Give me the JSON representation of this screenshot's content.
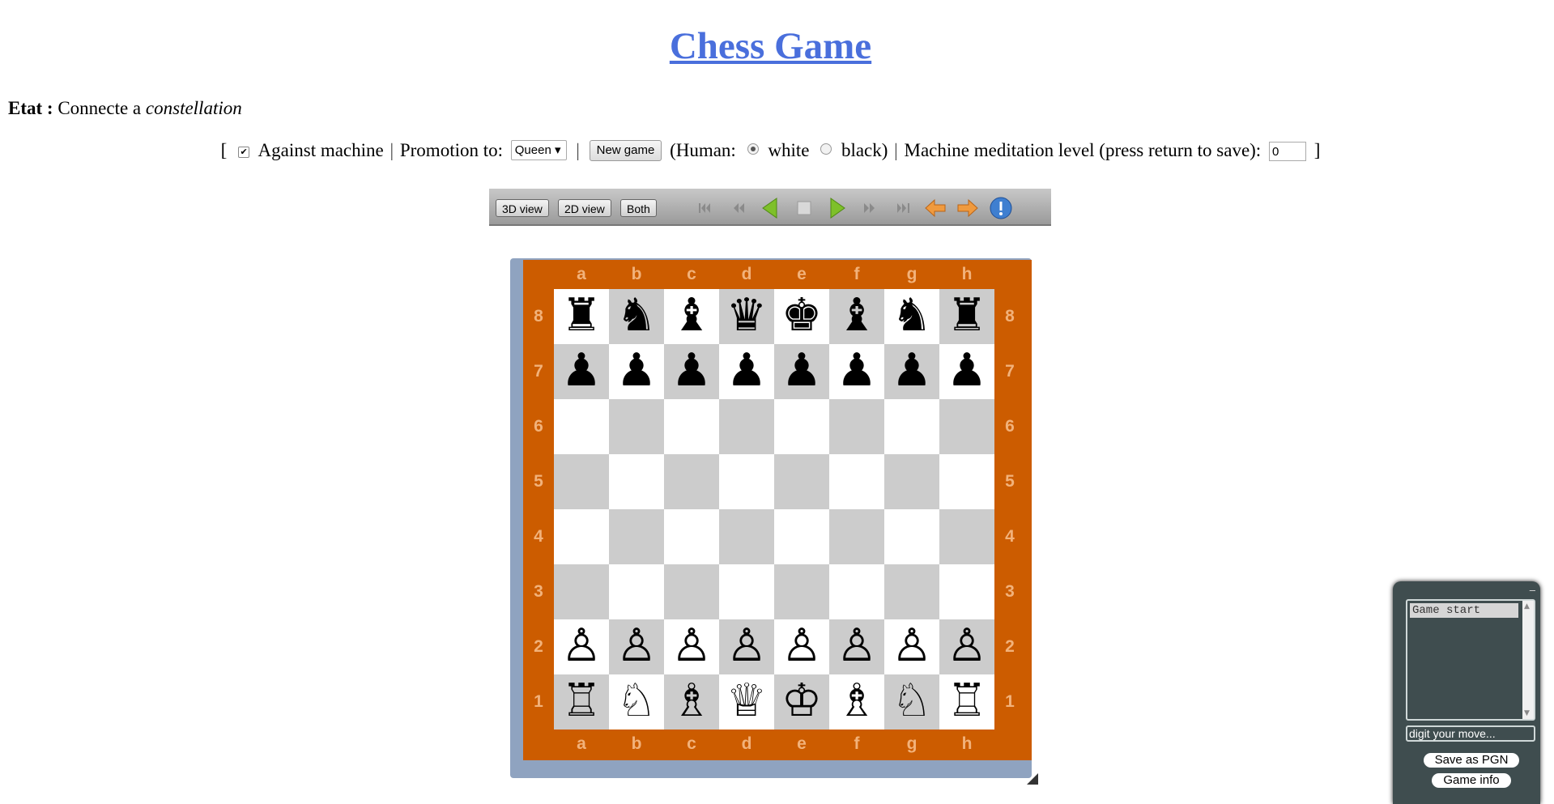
{
  "title": "Chess Game",
  "status": {
    "label": "Etat :",
    "text": "Connecte a",
    "peer": "constellation"
  },
  "controls": {
    "open_bracket": "[",
    "against_machine_checked": true,
    "against_machine_label": "Against machine",
    "promotion_label": "Promotion to:",
    "promotion_value": "Queen ▾",
    "new_game_label": "New game",
    "human_label": "(Human:",
    "white_label": "white",
    "black_label": "black)",
    "human_color": "white",
    "level_label": "Machine meditation level (press return to save):",
    "level_value": "0",
    "close_bracket": "]",
    "separator": "|"
  },
  "toolbar": {
    "view_3d": "3D view",
    "view_2d": "2D view",
    "view_both": "Both",
    "icons": [
      "first-move-icon",
      "fast-backward-icon",
      "back-icon",
      "stop-icon",
      "play-icon",
      "fast-forward-icon",
      "last-move-icon",
      "undo-icon",
      "redo-icon",
      "info-icon"
    ]
  },
  "board": {
    "files": [
      "a",
      "b",
      "c",
      "d",
      "e",
      "f",
      "g",
      "h"
    ],
    "ranks": [
      "8",
      "7",
      "6",
      "5",
      "4",
      "3",
      "2",
      "1"
    ],
    "position": [
      [
        "♜",
        "♞",
        "♝",
        "♛",
        "♚",
        "♝",
        "♞",
        "♜"
      ],
      [
        "♟",
        "♟",
        "♟",
        "♟",
        "♟",
        "♟",
        "♟",
        "♟"
      ],
      [
        "",
        "",
        "",
        "",
        "",
        "",
        "",
        ""
      ],
      [
        "",
        "",
        "",
        "",
        "",
        "",
        "",
        ""
      ],
      [
        "",
        "",
        "",
        "",
        "",
        "",
        "",
        ""
      ],
      [
        "",
        "",
        "",
        "",
        "",
        "",
        "",
        ""
      ],
      [
        "♙",
        "♙",
        "♙",
        "♙",
        "♙",
        "♙",
        "♙",
        "♙"
      ],
      [
        "♖",
        "♘",
        "♗",
        "♕",
        "♔",
        "♗",
        "♘",
        "♖"
      ]
    ],
    "colors": {
      "frame": "#cc5c00",
      "coordinates": "#f2b27a",
      "light_square": "#ffffff",
      "dark_square": "#cccccc"
    }
  },
  "panel": {
    "minimize": "–",
    "moves": [
      "Game start"
    ],
    "move_input": "digit your move...",
    "save_pgn": "Save as PGN",
    "game_info": "Game info"
  }
}
